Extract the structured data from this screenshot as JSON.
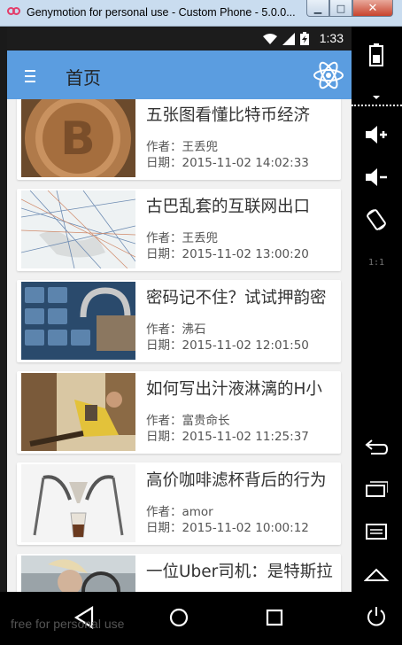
{
  "window": {
    "title": "Genymotion for personal use - Custom Phone - 5.0.0...",
    "minimize_label": "▁",
    "maximize_label": "□",
    "close_label": "✕"
  },
  "status_bar": {
    "time": "1:33"
  },
  "app_bar": {
    "title": "首页",
    "menu_icon": "menu-icon",
    "action_icon": "atom-icon"
  },
  "articles": [
    {
      "title": "五张图看懂比特币经济",
      "author": "作者：王丢兜",
      "date": "日期：2015-11-02 14:02:33",
      "thumb": "bitcoin-image"
    },
    {
      "title": "古巴乱套的互联网出口",
      "author": "作者：王丢兜",
      "date": "日期：2015-11-02 13:00:20",
      "thumb": "network-map-image"
    },
    {
      "title": "密码记不住？试试押韵密",
      "author": "作者：沸石",
      "date": "日期：2015-11-02 12:01:50",
      "thumb": "keyboard-lock-image"
    },
    {
      "title": "如何写出汁液淋漓的H小",
      "author": "作者：富贵命长",
      "date": "日期：2015-11-02 11:25:37",
      "thumb": "reading-woman-image"
    },
    {
      "title": "高价咖啡滤杯背后的行为",
      "author": "作者：amor",
      "date": "日期：2015-11-02 10:00:12",
      "thumb": "coffee-dripper-image"
    },
    {
      "title": "一位Uber司机：是特斯拉",
      "author": "",
      "date": "",
      "thumb": "car-driver-image"
    }
  ],
  "nav": {
    "back_icon": "back-triangle-icon",
    "home_icon": "home-circle-icon",
    "recents_icon": "recents-square-icon"
  },
  "sidebar": [
    "battery-icon",
    "volume-up-icon",
    "volume-down-icon",
    "rotate-icon",
    "pixel-ratio-icon",
    "back-icon",
    "recents-icon",
    "menu-icon",
    "home-icon",
    "power-icon"
  ],
  "sidebar_labels": {
    "pixel_ratio": "1:1"
  },
  "watermark": "free for personal use",
  "colors": {
    "app_bar": "#5b9de0",
    "title_bar": "#c9dcef",
    "card_bg": "#ffffff"
  }
}
